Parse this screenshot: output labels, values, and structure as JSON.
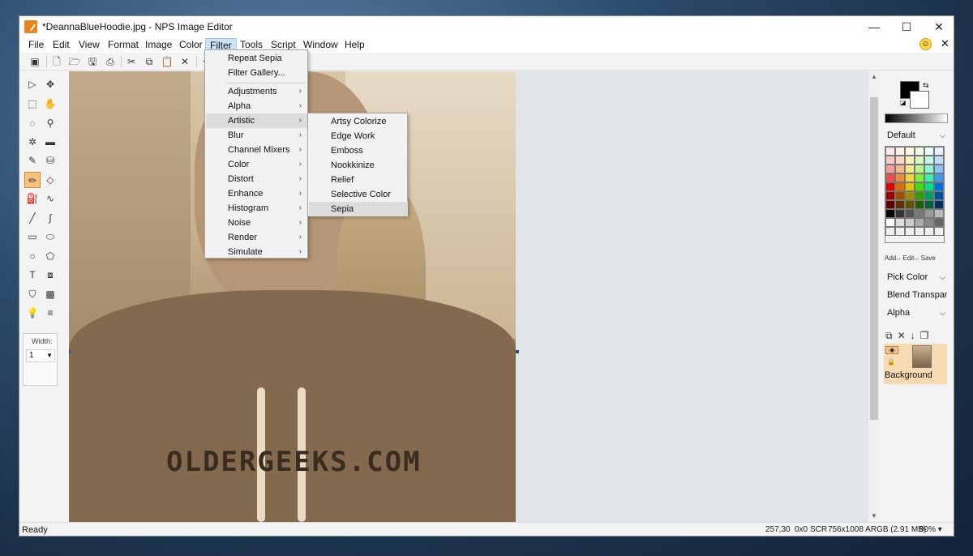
{
  "window": {
    "title": "*DeannaBlueHoodie.jpg - NPS Image Editor"
  },
  "menubar": [
    "File",
    "Edit",
    "View",
    "Format",
    "Image",
    "Color",
    "Filter",
    "Tools",
    "Script",
    "Window",
    "Help"
  ],
  "filter_menu": {
    "top_items": [
      "Repeat Sepia",
      "Filter Gallery..."
    ],
    "items": [
      "Adjustments",
      "Alpha",
      "Artistic",
      "Blur",
      "Channel Mixers",
      "Color",
      "Distort",
      "Enhance",
      "Histogram",
      "Noise",
      "Render",
      "Simulate"
    ],
    "highlighted": "Artistic"
  },
  "artistic_submenu": {
    "items": [
      "Artsy Colorize",
      "Edge Work",
      "Emboss",
      "Nookkinize",
      "Relief",
      "Selective Color",
      "Sepia"
    ],
    "highlighted": "Sepia"
  },
  "tools_panel": {
    "width_label": "Width:",
    "width_value": "1"
  },
  "photo": {
    "shirt_text": "OLDERGEEKS.COM"
  },
  "right_panel": {
    "palette_name": "Default",
    "palette_add": "Add",
    "palette_edit": "Edit",
    "palette_save": "Save",
    "pick_color": "Pick Color",
    "blend": "Blend Transparent",
    "alpha": "Alpha",
    "layer_name": "Background"
  },
  "status": {
    "text": "Ready",
    "coords": "257,30",
    "selection": "0x0",
    "mode": "SCR",
    "image_info": "756x1008 ARGB (2.91 MB)",
    "zoom": "90%"
  },
  "colors": {
    "selected_tool": "#f6c27f",
    "menu_active": "#cce4f7",
    "layer_selected": "#f7d9b2"
  }
}
